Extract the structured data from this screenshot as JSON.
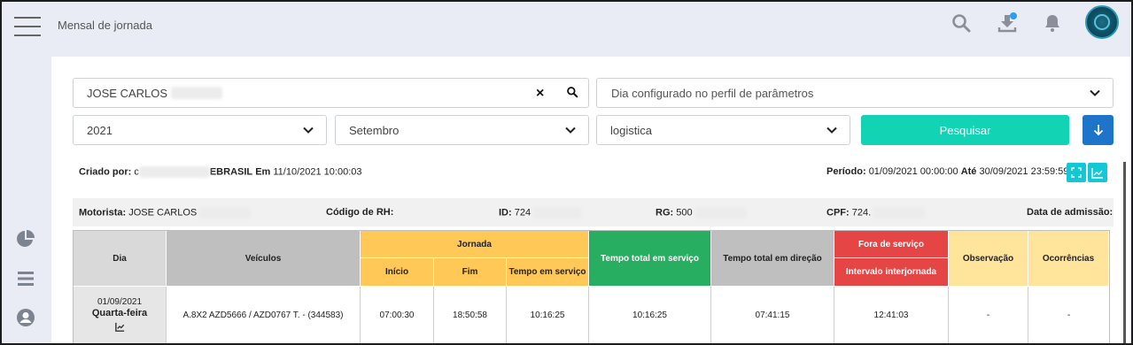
{
  "header": {
    "title": "Mensal de jornada",
    "icons": [
      "menu-icon",
      "search-icon",
      "download-icon",
      "bell-icon",
      "avatar"
    ],
    "accent": "#12d3b3"
  },
  "sidebar": {
    "icons": [
      "pie-chart-icon",
      "list-icon",
      "user-circle-icon"
    ]
  },
  "filters": {
    "driver_value": "JOSE CARLOS",
    "profile_placeholder": "Dia configurado no perfil de parâmetros",
    "year": "2021",
    "month": "Setembro",
    "group": "logistica",
    "search_button": "Pesquisar"
  },
  "report": {
    "created_by_label": "Criado por:",
    "created_by_prefix": "c",
    "created_by_suffix": "EBRASIL",
    "em_label": "Em",
    "created_at": "11/10/2021 10:00:03",
    "period_label": "Período:",
    "period_start": "01/09/2021 00:00:00",
    "ate_label": "Até",
    "period_end": "30/09/2021 23:59:59"
  },
  "driver_info": {
    "motorista_label": "Motorista:",
    "motorista_value": "JOSE CARLOS",
    "codigo_rh_label": "Código de RH:",
    "id_label": "ID:",
    "id_value": "724",
    "rg_label": "RG:",
    "rg_value": "500",
    "cpf_label": "CPF:",
    "cpf_value": "724.",
    "admissao_label": "Data de admissão:"
  },
  "table": {
    "headers": {
      "dia": "Dia",
      "veiculos": "Veículos",
      "jornada": "Jornada",
      "inicio": "Início",
      "fim": "Fim",
      "tempo_servico": "Tempo em serviço",
      "tempo_total_servico": "Tempo total em serviço",
      "tempo_total_direcao": "Tempo total em direção",
      "fora_servico": "Fora de serviço",
      "intervalo": "Intervalo interjornada",
      "observacao": "Observação",
      "ocorrencias": "Ocorrências"
    },
    "colors": {
      "gray_light": "#d9d9d9",
      "gray": "#bfbfbf",
      "orange": "#ffc857",
      "green": "#27ae60",
      "red": "#e64545",
      "yellow": "#ffe49c"
    },
    "rows": [
      {
        "date": "01/09/2021",
        "weekday": "Quarta-feira",
        "veiculos": "A.8X2 AZD5666 / AZD0767 T. - (344583)",
        "inicio": "07:00:30",
        "fim": "18:50:58",
        "tempo_servico": "10:16:25",
        "tempo_total_servico": "10:16:25",
        "tempo_total_direcao": "07:41:15",
        "intervalo": "12:41:03",
        "observacao": "-",
        "ocorrencias": "-"
      }
    ]
  }
}
